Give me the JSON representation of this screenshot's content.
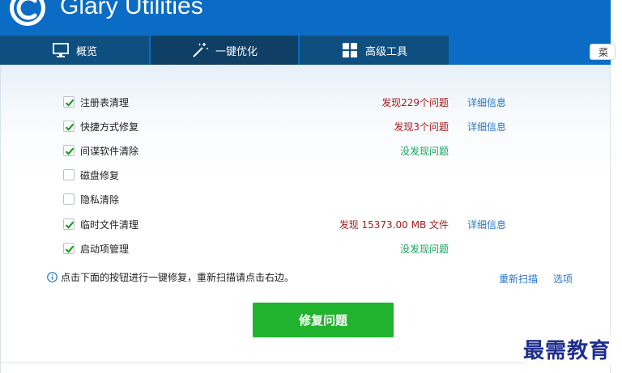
{
  "app": {
    "title": "Glary Utilities"
  },
  "tabs": [
    {
      "label": "概览",
      "icon": "monitor-icon"
    },
    {
      "label": "一键优化",
      "icon": "magic-wand-icon"
    },
    {
      "label": "高级工具",
      "icon": "grid-icon"
    }
  ],
  "menu": {
    "label": "菜"
  },
  "items": [
    {
      "label": "注册表清理",
      "checked": true,
      "status": "发现229个问题",
      "status_color": "#a41b1b",
      "detail": "详细信息"
    },
    {
      "label": "快捷方式修复",
      "checked": true,
      "status": "发现3个问题",
      "status_color": "#a41b1b",
      "detail": "详细信息"
    },
    {
      "label": "间谍软件清除",
      "checked": true,
      "status": "没发现问题",
      "status_color": "#19a25a",
      "detail": ""
    },
    {
      "label": "磁盘修复",
      "checked": false,
      "status": "",
      "status_color": "",
      "detail": ""
    },
    {
      "label": "隐私清除",
      "checked": false,
      "status": "",
      "status_color": "",
      "detail": ""
    },
    {
      "label": "临时文件清理",
      "checked": true,
      "status": "发现 15373.00 MB 文件",
      "status_color": "#a41b1b",
      "detail": "详细信息"
    },
    {
      "label": "启动项管理",
      "checked": true,
      "status": "没发现问题",
      "status_color": "#19a25a",
      "detail": ""
    }
  ],
  "info": {
    "text": "点击下面的按钮进行一键修复，重新扫描请点击右边。",
    "icon": "info-icon"
  },
  "links": {
    "rescan": "重新扫描",
    "options": "选项"
  },
  "fix_button": {
    "label": "修复问题"
  },
  "watermark": {
    "text": "最需教育"
  },
  "colors": {
    "header": "#0a6cc4",
    "tab_dark": "#0f4f80",
    "tab_active": "#103f66",
    "accent_button": "#21b32d",
    "link": "#2a76c6"
  }
}
